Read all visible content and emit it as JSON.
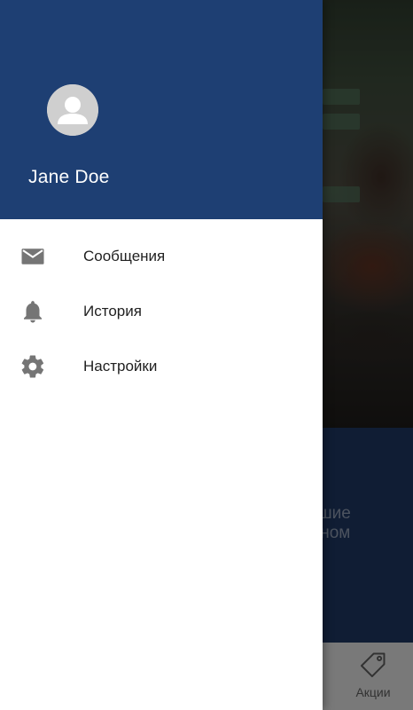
{
  "drawer": {
    "user_name": "Jane Doe",
    "header_color": "#1e3f73",
    "items": [
      {
        "label": "Сообщения",
        "icon": "mail-icon"
      },
      {
        "label": "История",
        "icon": "bell-icon"
      },
      {
        "label": "Настройки",
        "icon": "gear-icon"
      }
    ]
  },
  "background": {
    "banner_text_line1": "учшие",
    "banner_text_line2": "одном",
    "bottom_nav": {
      "partial_left_label": ".",
      "promo_label": "Акции",
      "promo_icon": "tag-icon"
    }
  }
}
